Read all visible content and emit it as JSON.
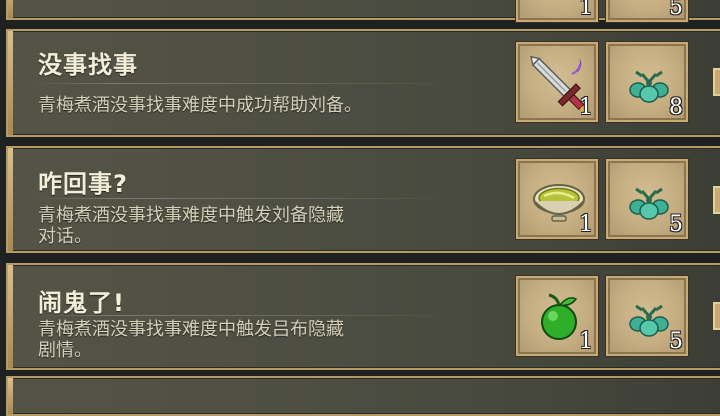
{
  "achievements": [
    {
      "title": "没事找事",
      "description": [
        "青梅煮酒没事找事难度中成功帮助刘备。"
      ],
      "rewards": [
        {
          "icon": "sword-icon",
          "count": "1"
        },
        {
          "icon": "jade-pendant-icon",
          "count": "8"
        }
      ]
    },
    {
      "title": "咋回事?",
      "description": [
        "青梅煮酒没事找事难度中触发刘备隐藏",
        "对话。"
      ],
      "rewards": [
        {
          "icon": "wine-bowl-icon",
          "count": "1"
        },
        {
          "icon": "jade-pendant-icon",
          "count": "5"
        }
      ]
    },
    {
      "title": "闹鬼了!",
      "description": [
        "青梅煮酒没事找事难度中触发吕布隐藏",
        "剧情。"
      ],
      "rewards": [
        {
          "icon": "green-plum-icon",
          "count": "1"
        },
        {
          "icon": "jade-pendant-icon",
          "count": "5"
        }
      ]
    }
  ],
  "partial": {
    "top_counts": [
      "1",
      "5"
    ]
  },
  "colors": {
    "frame": "#b49a64",
    "slot_bg": "#c4ad81",
    "title_text": "#f3eed8",
    "desc_text": "#d4d0b8"
  }
}
